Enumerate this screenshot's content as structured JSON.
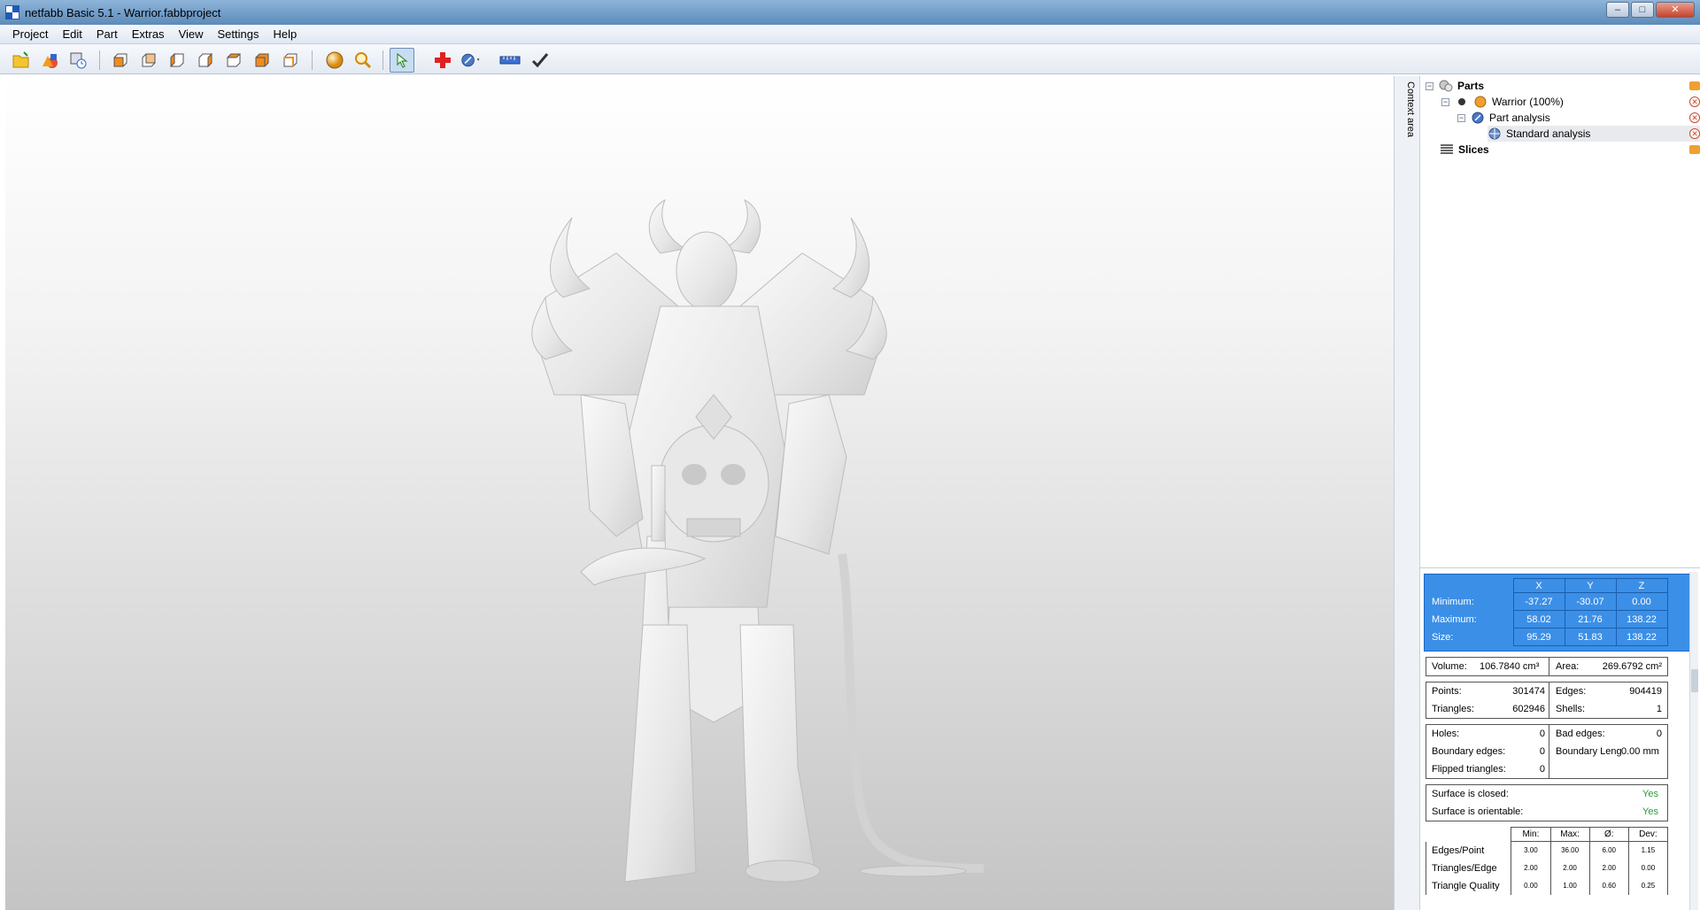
{
  "window": {
    "title": "netfabb Basic 5.1 - Warrior.fabbproject",
    "buttons": {
      "minimize": "–",
      "maximize": "□",
      "close": "✕"
    }
  },
  "menu": [
    "Project",
    "Edit",
    "Part",
    "Extras",
    "View",
    "Settings",
    "Help"
  ],
  "toolbar": {
    "icons": [
      "open-project-icon",
      "add-part-icon",
      "history-icon",
      "view-front-icon",
      "view-back-icon",
      "view-left-icon",
      "view-right-icon",
      "view-top-icon",
      "view-bottom-icon",
      "view-3d-icon",
      "sphere-shading-icon",
      "zoom-icon",
      "select-pointer-icon",
      "repair-cross-icon",
      "analysis-dropdown-icon",
      "measure-ruler-icon",
      "apply-check-icon"
    ]
  },
  "context_area": {
    "label": "Context area"
  },
  "tree": {
    "parts": {
      "label": "Parts"
    },
    "warrior": {
      "label": "Warrior (100%)"
    },
    "part_analysis": {
      "label": "Part analysis"
    },
    "standard_analysis": {
      "label": "Standard analysis"
    },
    "slices": {
      "label": "Slices"
    }
  },
  "bbox": {
    "headers": [
      "X",
      "Y",
      "Z"
    ],
    "rows": [
      {
        "label": "Minimum:",
        "x": "-37.27",
        "y": "-30.07",
        "z": "0.00"
      },
      {
        "label": "Maximum:",
        "x": "58.02",
        "y": "21.76",
        "z": "138.22"
      },
      {
        "label": "Size:",
        "x": "95.29",
        "y": "51.83",
        "z": "138.22"
      }
    ]
  },
  "volume": {
    "label": "Volume:",
    "value": "106.7840 cm³"
  },
  "area": {
    "label": "Area:",
    "value": "269.6792 cm²"
  },
  "points": {
    "label": "Points:",
    "value": "301474"
  },
  "edges": {
    "label": "Edges:",
    "value": "904419"
  },
  "triangles": {
    "label": "Triangles:",
    "value": "602946"
  },
  "shells": {
    "label": "Shells:",
    "value": "1"
  },
  "holes": {
    "label": "Holes:",
    "value": "0"
  },
  "bad_edges": {
    "label": "Bad edges:",
    "value": "0"
  },
  "boundary_edges": {
    "label": "Boundary edges:",
    "value": "0"
  },
  "boundary_length": {
    "label": "Boundary Leng",
    "value": "0.00 mm"
  },
  "flipped_triangles": {
    "label": "Flipped triangles:",
    "value": "0"
  },
  "surface_closed": {
    "label": "Surface is closed:",
    "value": "Yes"
  },
  "surface_orientable": {
    "label": "Surface is orientable:",
    "value": "Yes"
  },
  "quality": {
    "headers": [
      "Min:",
      "Max:",
      "Ø:",
      "Dev:"
    ],
    "rows": [
      {
        "label": "Edges/Point",
        "min": "3.00",
        "max": "36.00",
        "avg": "6.00",
        "dev": "1.15"
      },
      {
        "label": "Triangles/Edge",
        "min": "2.00",
        "max": "2.00",
        "avg": "2.00",
        "dev": "0.00"
      },
      {
        "label": "Triangle Quality",
        "min": "0.00",
        "max": "1.00",
        "avg": "0.60",
        "dev": "0.25"
      }
    ]
  },
  "colors": {
    "selection_blue": "#3b8fe7",
    "ok_green": "#2c9a3c",
    "remove_red": "#c9492a"
  }
}
